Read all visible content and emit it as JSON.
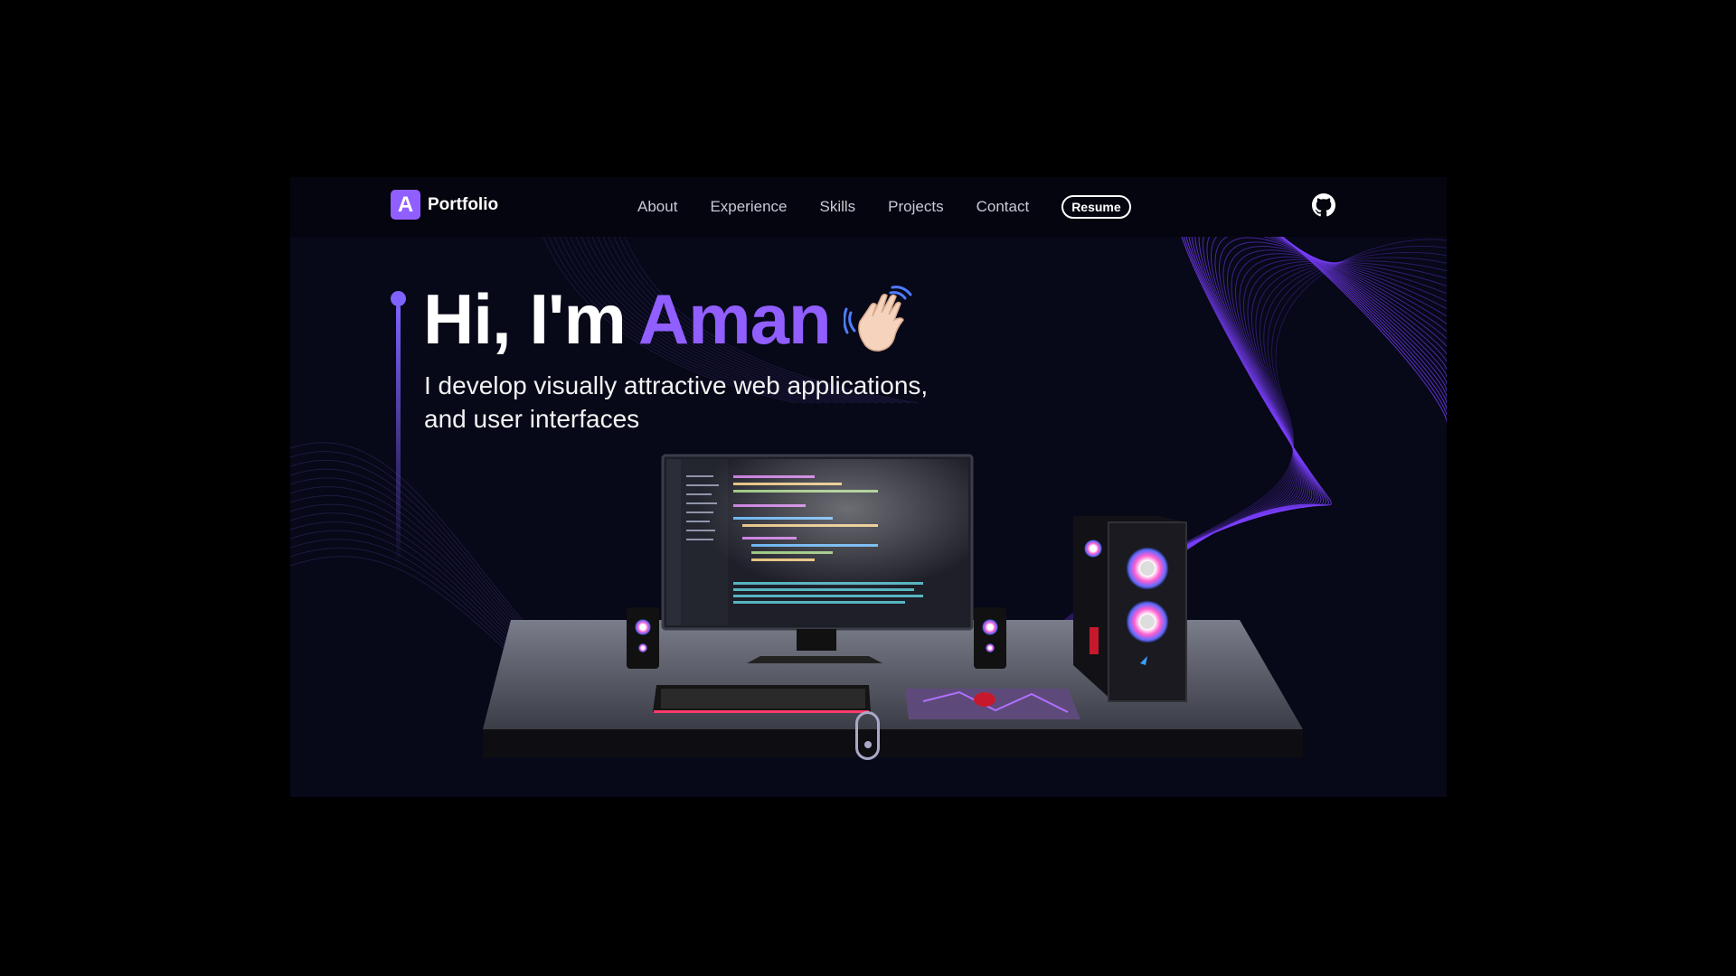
{
  "brand": {
    "logo_letter": "A",
    "name": "Portfolio"
  },
  "nav": {
    "items": [
      {
        "label": "About"
      },
      {
        "label": "Experience"
      },
      {
        "label": "Skills"
      },
      {
        "label": "Projects"
      },
      {
        "label": "Contact"
      }
    ],
    "resume_label": "Resume"
  },
  "hero": {
    "greeting": "Hi, I'm",
    "name": "Aman",
    "subtitle_line1": "I develop visually attractive web applications,",
    "subtitle_line2": "and user interfaces"
  },
  "colors": {
    "accent": "#915eff",
    "background": "#070818",
    "navbar": "#050510",
    "wave_lines": "#7b3fff"
  },
  "icons": {
    "github": "github-icon",
    "wave": "waving-hand-icon",
    "scroll": "mouse-scroll-icon"
  }
}
